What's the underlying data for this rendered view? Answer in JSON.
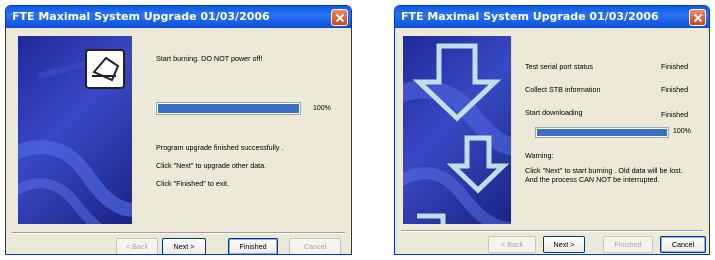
{
  "dialog1": {
    "title": "FTE Maximal System Upgrade 01/03/2006",
    "status_heading": "Start burning. DO NOT power off!",
    "progress_value": 100,
    "progress_text": "100%",
    "messages": [
      "Program upgrade finished successfully .",
      "Click \"Next\" to upgrade other data.",
      "Click \"Finished\" to exit."
    ],
    "buttons": {
      "back": "< Back",
      "next": "Next >",
      "finished": "Finished",
      "cancel": "Cancel"
    }
  },
  "dialog2": {
    "title": "FTE Maximal System Upgrade 01/03/2006",
    "steps": [
      {
        "label": "Test serial port status",
        "status": "Finished"
      },
      {
        "label": "Collect STB information",
        "status": "Finished"
      },
      {
        "label": "Start downloading",
        "status": "Finished"
      }
    ],
    "progress_value": 100,
    "progress_text": "100%",
    "warning_label": "Warning:",
    "warning_text": "Click \"Next\" to start burning . Old data will be lost. And the process CAN NOT be interrupted.",
    "buttons": {
      "back": "< Back",
      "next": "Next >",
      "finished": "Finished",
      "cancel": "Cancel"
    }
  }
}
